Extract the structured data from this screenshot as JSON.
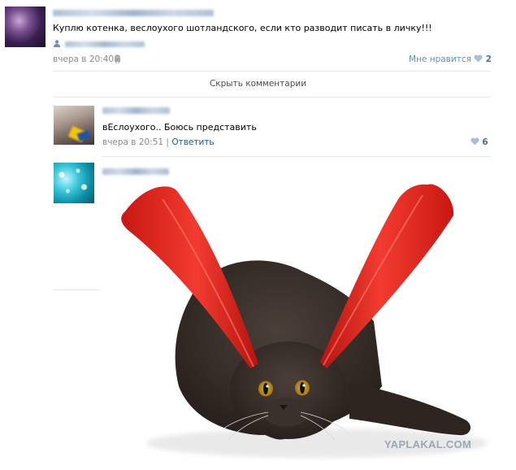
{
  "post": {
    "text": "Куплю котенка, веслоухого шотландского, если кто разводит писать в личку!!!",
    "timestamp": "вчера в 20:40",
    "like_label": "Мне нравится",
    "like_count": "2"
  },
  "comments_toggle": "Скрыть комментарии",
  "replies": [
    {
      "text": "вЕслоухого.. Боюсь представить",
      "timestamp": "вчера в 20:51",
      "separator": "|",
      "reply_label": "Ответить",
      "like_count": "6"
    }
  ],
  "watermark": "YAPLAKAL.COM",
  "colors": {
    "link": "#2b587a",
    "meta": "#8a8a8a",
    "like": "#6a8cb0",
    "paddle": "#e3231f",
    "cat": "#3a302c"
  }
}
